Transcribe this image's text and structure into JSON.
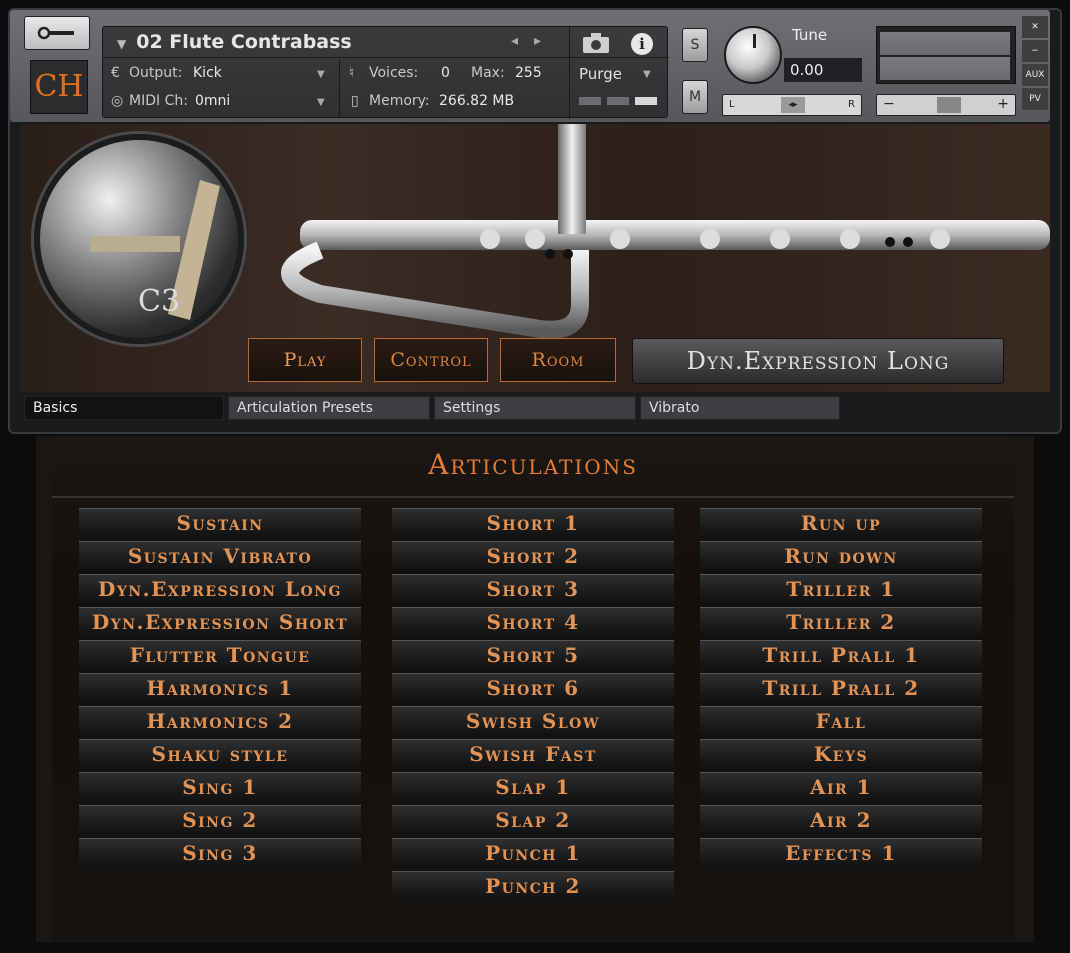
{
  "header": {
    "instrument_name": "02 Flute Contrabass",
    "logo_text": "CH",
    "output_label": "Output:",
    "output_value": "Kick",
    "midi_label": "MIDI Ch:",
    "midi_value": "0mni",
    "voices_label": "Voices:",
    "voices_value": "0",
    "max_label": "Max:",
    "max_value": "255",
    "memory_label": "Memory:",
    "memory_value": "266.82 MB",
    "purge_label": "Purge",
    "solo_label": "S",
    "mute_label": "M",
    "tune_label": "Tune",
    "tune_value": "0.00",
    "pan_left": "L",
    "pan_right": "R",
    "vol_minus": "−",
    "vol_plus": "+",
    "side_buttons": [
      "✕",
      "−",
      "AUX",
      "PV"
    ]
  },
  "artwork": {
    "badge_note": "C3",
    "tabs": [
      "Play",
      "Control",
      "Room"
    ],
    "current_articulation": "Dyn.Expression Long"
  },
  "tab_strip": [
    "Basics",
    "Articulation Presets",
    "Settings",
    "Vibrato"
  ],
  "articulations": {
    "title": "Articulations",
    "col1": [
      "Sustain",
      "Sustain Vibrato",
      "Dyn.Expression Long",
      "Dyn.Expression Short",
      "Flutter Tongue",
      "Harmonics 1",
      "Harmonics 2",
      "Shaku style",
      "Sing 1",
      "Sing 2",
      "Sing 3"
    ],
    "col2": [
      "Short 1",
      "Short 2",
      "Short 3",
      "Short 4",
      "Short 5",
      "Short 6",
      "Swish Slow",
      "Swish Fast",
      "Slap 1",
      "Slap 2",
      "Punch 1",
      "Punch 2"
    ],
    "col3": [
      "Run up",
      "Run down",
      "Triller 1",
      "Triller 2",
      "Trill Prall 1",
      "Trill Prall 2",
      "Fall",
      "Keys",
      "Air 1",
      "Air 2",
      "Effects 1"
    ]
  },
  "colors": {
    "accent": "#e47d33",
    "button_text": "#e39353"
  }
}
